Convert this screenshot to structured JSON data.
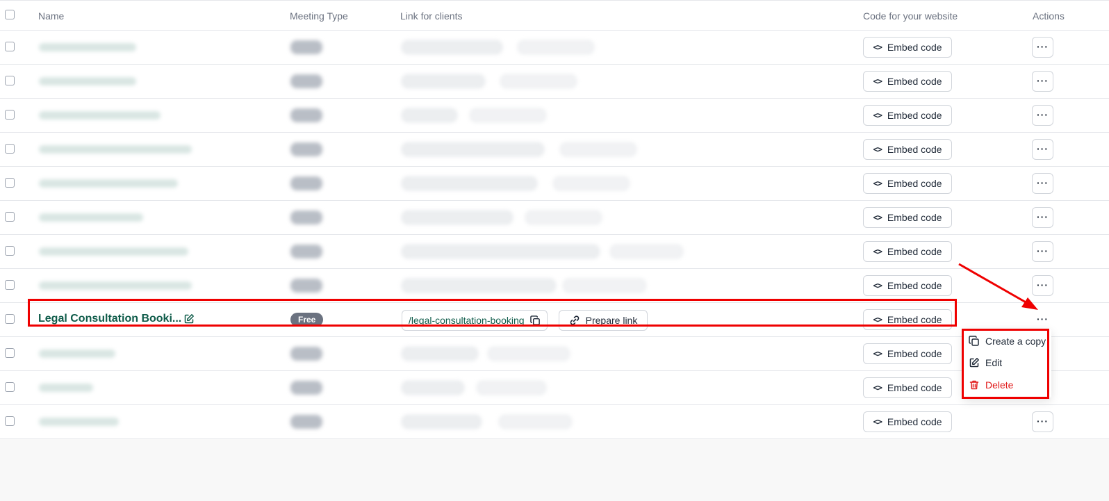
{
  "columns": {
    "name": "Name",
    "meeting_type": "Meeting Type",
    "link": "Link for clients",
    "code": "Code for your website",
    "actions": "Actions"
  },
  "embed_label": "Embed code",
  "more_label": "···",
  "focus_row": {
    "title": "Legal Consultation Booki...",
    "badge": "Free",
    "slug": "/legal-consultation-booking",
    "prepare_label": "Prepare link"
  },
  "menu": {
    "items": [
      {
        "label": "Create a copy",
        "icon": "copy-icon"
      },
      {
        "label": "Edit",
        "icon": "edit-icon"
      },
      {
        "label": "Delete",
        "icon": "trash-icon"
      }
    ]
  },
  "colors": {
    "accent": "#0f5c4a",
    "highlight": "#ef0000",
    "danger": "#e11d1d",
    "badge_bg": "#6b7280"
  }
}
